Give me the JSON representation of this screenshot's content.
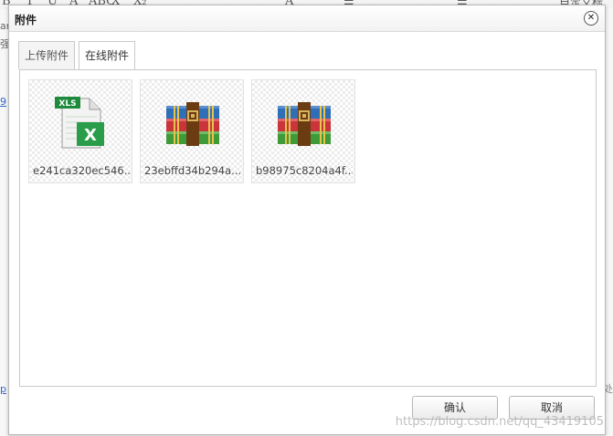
{
  "background": {
    "toolbar_glyphs": [
      "B",
      "I",
      "U",
      "A",
      "ABC",
      "X",
      "X₂",
      "A",
      "☰",
      "☰",
      "自定义标"
    ],
    "left_fragments": [
      "ar",
      "强",
      "9",
      "p"
    ],
    "right_fragments": [
      "处"
    ]
  },
  "dialog": {
    "title": "附件",
    "close_symbol": "✕",
    "tabs": [
      {
        "label": "上传附件",
        "active": false
      },
      {
        "label": "在线附件",
        "active": true
      }
    ],
    "files": [
      {
        "name": "e241ca320ec546...",
        "type": "xls",
        "icon": "excel-file-icon"
      },
      {
        "name": "23ebffd34b294a...",
        "type": "rar",
        "icon": "winrar-archive-icon"
      },
      {
        "name": "b98975c8204a4f...",
        "type": "rar",
        "icon": "winrar-archive-icon"
      }
    ],
    "buttons": {
      "ok": "确认",
      "cancel": "取消"
    }
  },
  "watermark": "https://blog.csdn.net/qq_43419105",
  "colors": {
    "excel_green": "#1e8a3c",
    "rar_blue": "#2f6fb7",
    "rar_red": "#c9353b",
    "rar_green": "#3f9a3a",
    "strap_brown": "#6b3b12"
  }
}
